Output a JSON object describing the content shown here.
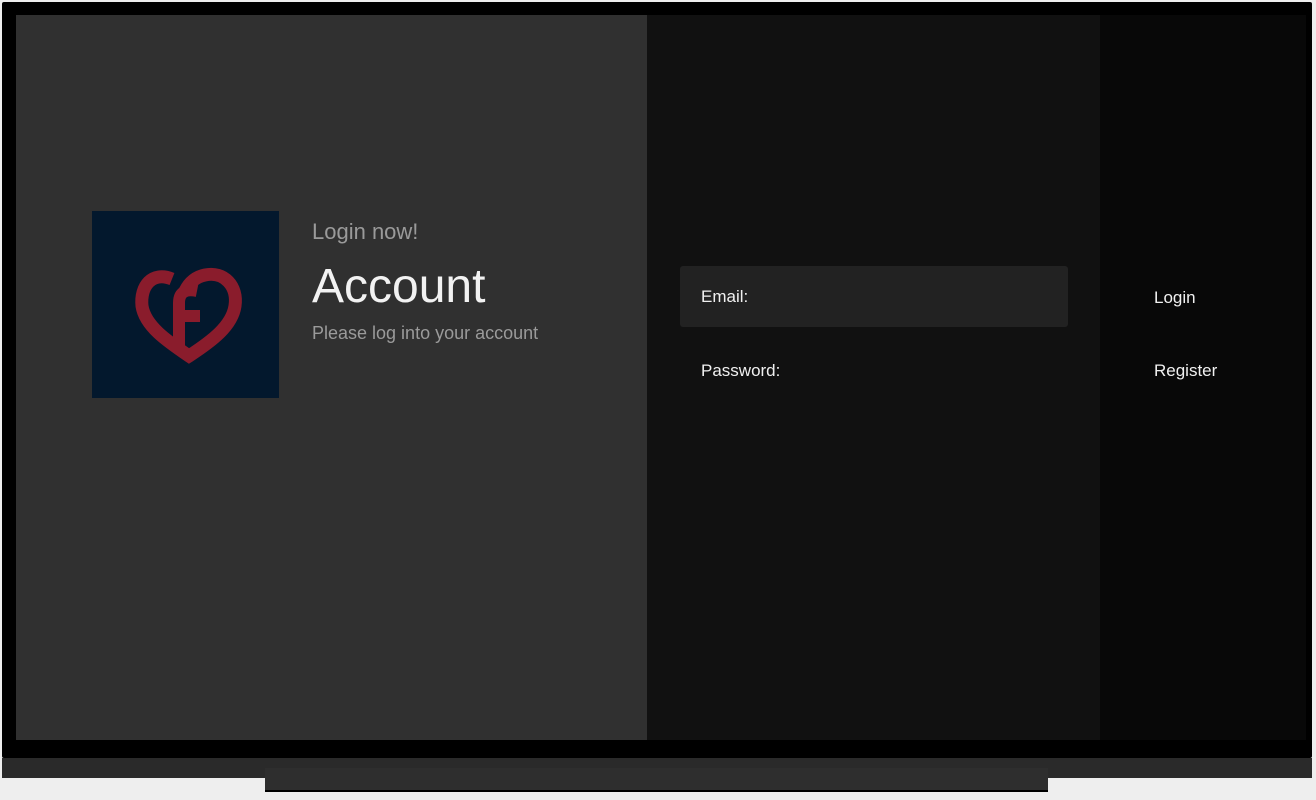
{
  "header": {
    "subtitle": "Login now!",
    "title": "Account",
    "description": "Please log into your account"
  },
  "form": {
    "email_label": "Email:",
    "password_label": "Password:"
  },
  "actions": {
    "login": "Login",
    "register": "Register"
  },
  "colors": {
    "logo_bg": "#03182d",
    "logo_heart": "#8a1c2c",
    "panel_left": "#303030",
    "panel_mid": "#111111",
    "panel_right": "#080808"
  }
}
